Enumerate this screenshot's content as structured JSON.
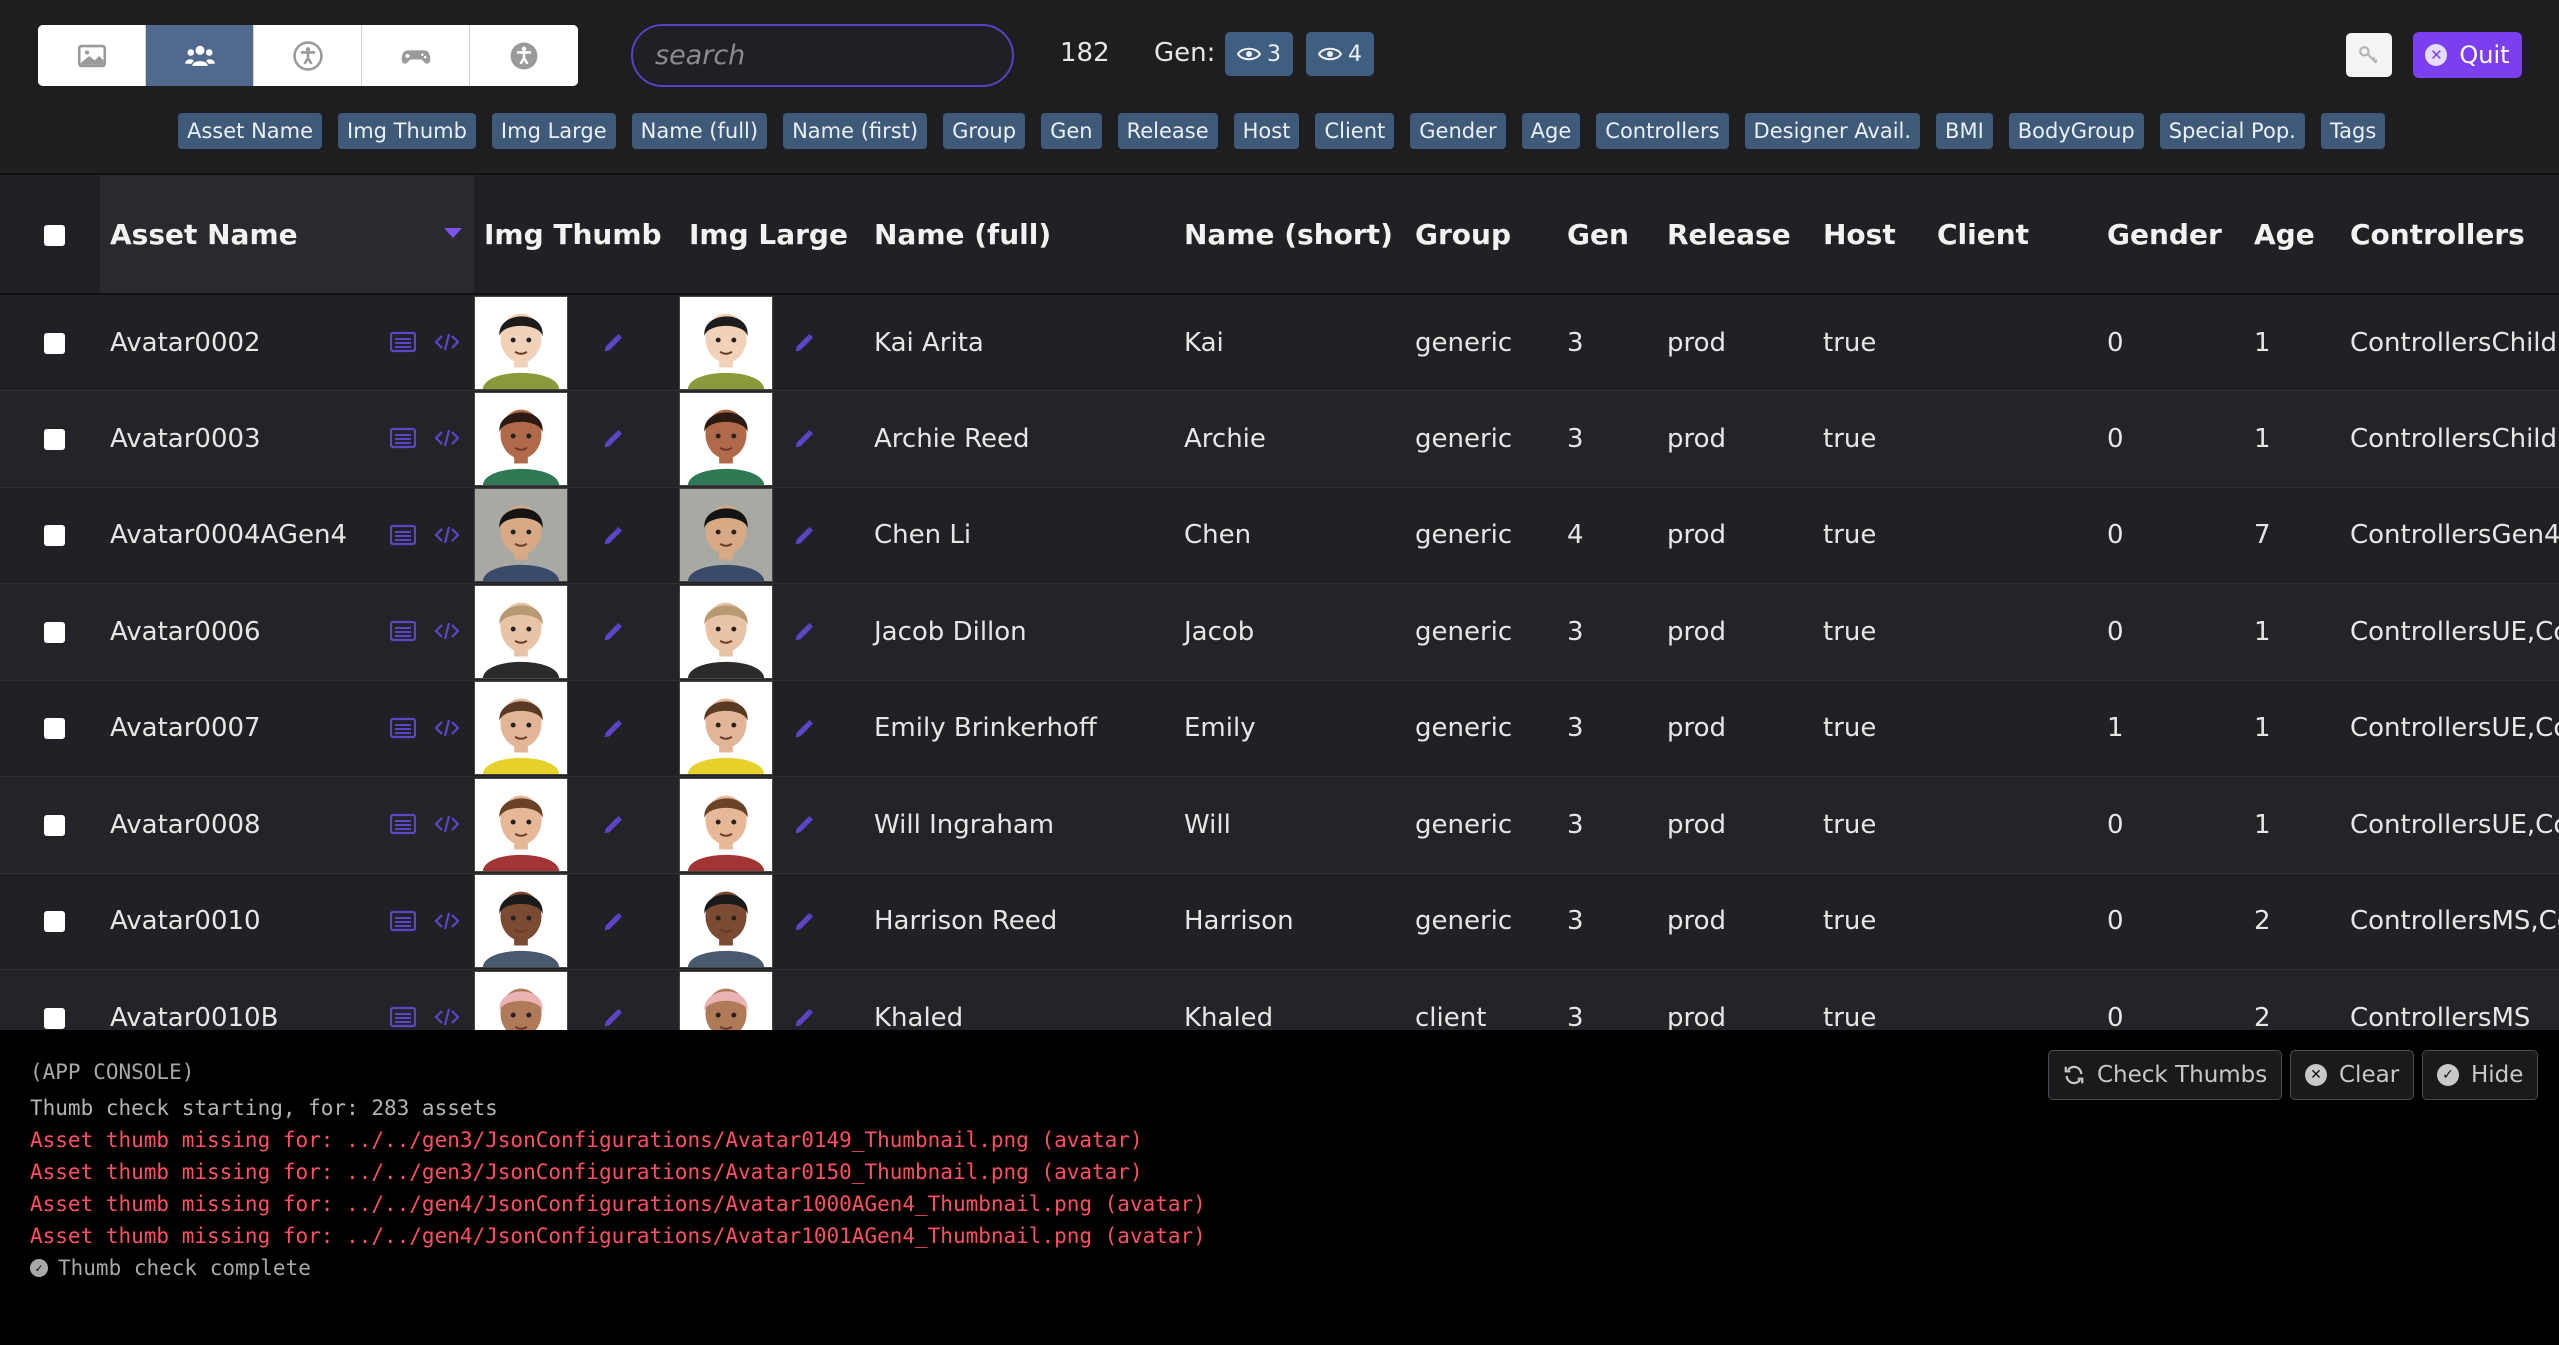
{
  "header": {
    "view_tabs": [
      {
        "icon": "image-icon",
        "active": false
      },
      {
        "icon": "users-icon",
        "active": true
      },
      {
        "icon": "accessibility-icon",
        "active": false
      },
      {
        "icon": "gamepad-icon",
        "active": false
      },
      {
        "icon": "accessibility-alt-icon",
        "active": false
      }
    ],
    "search_placeholder": "search",
    "count": "182",
    "gen_label": "Gen:",
    "gen_badges": [
      "3",
      "4"
    ],
    "quit_label": "Quit",
    "accent_color": "#7b3ff0"
  },
  "column_tags": [
    "Asset Name",
    "Img Thumb",
    "Img Large",
    "Name (full)",
    "Name (first)",
    "Group",
    "Gen",
    "Release",
    "Host",
    "Client",
    "Gender",
    "Age",
    "Controllers",
    "Designer Avail.",
    "BMI",
    "BodyGroup",
    "Special Pop.",
    "Tags"
  ],
  "table": {
    "headers": [
      "Asset Name",
      "Img Thumb",
      "Img Large",
      "Name (full)",
      "Name (short)",
      "Group",
      "Gen",
      "Release",
      "Host",
      "Client",
      "Gender",
      "Age",
      "Controllers"
    ],
    "sorted_column": "Asset Name",
    "rows": [
      {
        "asset": "Avatar0002",
        "full": "Kai Arita",
        "short": "Kai",
        "group": "generic",
        "gen": "3",
        "release": "prod",
        "host": "true",
        "client": "",
        "gender": "0",
        "age": "1",
        "controllers": "ControllersChild,",
        "skin": "#f1d2b8",
        "hair": "#1c1c1c",
        "shirt": "#8a9a3a",
        "bg": "#ffffff"
      },
      {
        "asset": "Avatar0003",
        "full": "Archie Reed",
        "short": "Archie",
        "group": "generic",
        "gen": "3",
        "release": "prod",
        "host": "true",
        "client": "",
        "gender": "0",
        "age": "1",
        "controllers": "ControllersChild,",
        "skin": "#b06a4a",
        "hair": "#2a1a12",
        "shirt": "#2f7a55",
        "bg": "#ffffff"
      },
      {
        "asset": "Avatar0004AGen4",
        "full": "Chen Li",
        "short": "Chen",
        "group": "generic",
        "gen": "4",
        "release": "prod",
        "host": "true",
        "client": "",
        "gender": "0",
        "age": "7",
        "controllers": "ControllersGen4",
        "skin": "#d7a985",
        "hair": "#141414",
        "shirt": "#3a4a6a",
        "bg": "#a9a9a4"
      },
      {
        "asset": "Avatar0006",
        "full": "Jacob Dillon",
        "short": "Jacob",
        "group": "generic",
        "gen": "3",
        "release": "prod",
        "host": "true",
        "client": "",
        "gender": "0",
        "age": "1",
        "controllers": "ControllersUE,Co",
        "skin": "#e8c3a6",
        "hair": "#b79a72",
        "shirt": "#2b2b2b",
        "bg": "#ffffff"
      },
      {
        "asset": "Avatar0007",
        "full": "Emily Brinkerhoff",
        "short": "Emily",
        "group": "generic",
        "gen": "3",
        "release": "prod",
        "host": "true",
        "client": "",
        "gender": "1",
        "age": "1",
        "controllers": "ControllersUE,Co",
        "skin": "#e2b596",
        "hair": "#5a3a24",
        "shirt": "#e6d22a",
        "bg": "#ffffff"
      },
      {
        "asset": "Avatar0008",
        "full": "Will Ingraham",
        "short": "Will",
        "group": "generic",
        "gen": "3",
        "release": "prod",
        "host": "true",
        "client": "",
        "gender": "0",
        "age": "1",
        "controllers": "ControllersUE,Co",
        "skin": "#e6b898",
        "hair": "#6a4228",
        "shirt": "#a33434",
        "bg": "#ffffff"
      },
      {
        "asset": "Avatar0010",
        "full": "Harrison Reed",
        "short": "Harrison",
        "group": "generic",
        "gen": "3",
        "release": "prod",
        "host": "true",
        "client": "",
        "gender": "0",
        "age": "2",
        "controllers": "ControllersMS,Co",
        "skin": "#7a4a32",
        "hair": "#1a1a1a",
        "shirt": "#4a5a6e",
        "bg": "#ffffff"
      },
      {
        "asset": "Avatar0010B",
        "full": "Khaled",
        "short": "Khaled",
        "group": "client",
        "gen": "3",
        "release": "prod",
        "host": "true",
        "client": "",
        "gender": "0",
        "age": "2",
        "controllers": "ControllersMS",
        "skin": "#b07a58",
        "hair": "#e9b3b3",
        "shirt": "#cccccc",
        "bg": "#ffffff"
      }
    ]
  },
  "console": {
    "title": "(APP CONSOLE)",
    "lines": [
      {
        "type": "info",
        "text": "Thumb check starting, for: 283 assets"
      },
      {
        "type": "err",
        "text": "Asset thumb missing for: ../../gen3/JsonConfigurations/Avatar0149_Thumbnail.png (avatar)"
      },
      {
        "type": "err",
        "text": "Asset thumb missing for: ../../gen3/JsonConfigurations/Avatar0150_Thumbnail.png (avatar)"
      },
      {
        "type": "err",
        "text": "Asset thumb missing for: ../../gen4/JsonConfigurations/Avatar1000AGen4_Thumbnail.png (avatar)"
      },
      {
        "type": "err",
        "text": "Asset thumb missing for: ../../gen4/JsonConfigurations/Avatar1001AGen4_Thumbnail.png (avatar)"
      },
      {
        "type": "ok",
        "text": "Thumb check complete"
      }
    ],
    "buttons": {
      "check": "Check Thumbs",
      "clear": "Clear",
      "hide": "Hide"
    },
    "error_color": "#ff4f64"
  }
}
